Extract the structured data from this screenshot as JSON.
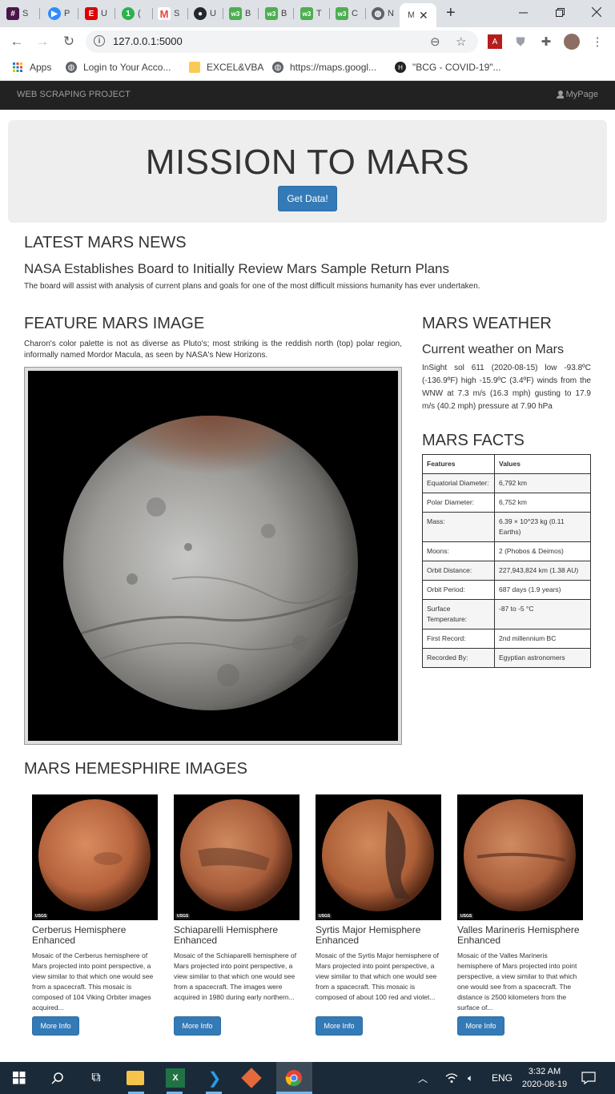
{
  "browser": {
    "tabs": [
      {
        "label": "S",
        "icon": "slack-icon",
        "color": "#4a154b"
      },
      {
        "label": "P",
        "icon": "zoom-icon",
        "color": "#2d8cff"
      },
      {
        "label": "U",
        "icon": "espn-icon",
        "color": "#d00"
      },
      {
        "label": "(",
        "icon": "counter-icon",
        "color": "#2bb24c"
      },
      {
        "label": "S",
        "icon": "gmail-icon",
        "color": "#ea4335"
      },
      {
        "label": "U",
        "icon": "github-icon",
        "color": "#24292e"
      },
      {
        "label": "B",
        "icon": "w3schools-icon",
        "color": "#4caf50"
      },
      {
        "label": "B",
        "icon": "w3schools-icon",
        "color": "#4caf50"
      },
      {
        "label": "T",
        "icon": "w3schools-icon",
        "color": "#4caf50"
      },
      {
        "label": "C",
        "icon": "w3schools-icon",
        "color": "#4caf50"
      },
      {
        "label": "N",
        "icon": "globe-icon",
        "color": "#5f6368"
      },
      {
        "label": "M",
        "icon": "page-icon",
        "color": "#5f6368"
      }
    ],
    "new_tab": "+",
    "url": "127.0.0.1:5000",
    "bookmarks": [
      {
        "label": "Apps",
        "icon": "apps-grid-icon"
      },
      {
        "label": "Login to Your Acco...",
        "icon": "globe-icon"
      },
      {
        "label": "EXCEL&VBA",
        "icon": "folder-icon"
      },
      {
        "label": "https://maps.googl...",
        "icon": "globe-icon"
      },
      {
        "label": "\"BCG - COVID-19\"...",
        "icon": "h-icon"
      }
    ]
  },
  "navbar": {
    "brand": "WEB SCRAPING PROJECT",
    "mypage": "MyPage"
  },
  "jumbotron": {
    "title": "MISSION TO MARS",
    "button": "Get Data!"
  },
  "news": {
    "heading": "LATEST MARS NEWS",
    "title": "NASA Establishes Board to Initially Review Mars Sample Return Plans",
    "paragraph": "The board will assist with analysis of current plans and goals for one of the most difficult missions humanity has ever undertaken."
  },
  "feature": {
    "heading": "FEATURE MARS IMAGE",
    "caption": "Charon's color palette is not as diverse as Pluto's; most striking is the reddish north (top) polar region, informally named Mordor Macula, as seen by NASA's New Horizons."
  },
  "weather": {
    "heading": "MARS WEATHER",
    "subheading": "Current weather on Mars",
    "text": "InSight sol 611 (2020-08-15) low -93.8ºC (-136.9ºF) high -15.9ºC (3.4ºF) winds from the WNW at 7.3 m/s (16.3 mph) gusting to 17.9 m/s (40.2 mph) pressure at 7.90 hPa"
  },
  "facts": {
    "heading": "MARS FACTS",
    "columns": [
      "Features",
      "Values"
    ],
    "rows": [
      [
        "Equatorial Diameter:",
        "6,792 km"
      ],
      [
        "Polar Diameter:",
        "6,752 km"
      ],
      [
        "Mass:",
        "6.39 × 10^23 kg (0.11 Earths)"
      ],
      [
        "Moons:",
        "2 (Phobos & Deimos)"
      ],
      [
        "Orbit Distance:",
        "227,943,824 km (1.38 AU)"
      ],
      [
        "Orbit Period:",
        "687 days (1.9 years)"
      ],
      [
        "Surface Temperature:",
        "-87 to -5 °C"
      ],
      [
        "First Record:",
        "2nd millennium BC"
      ],
      [
        "Recorded By:",
        "Egyptian astronomers"
      ]
    ]
  },
  "hemispheres": {
    "heading": "MARS HEMESPHIRE IMAGES",
    "items": [
      {
        "title": "Cerberus Hemisphere Enhanced",
        "desc": "Mosaic of the Cerberus hemisphere of Mars projected into point perspective, a view similar to that which one would see from a spacecraft. This mosaic is composed of 104 Viking Orbiter images acquired...",
        "button": "More Info",
        "badge": "USGS"
      },
      {
        "title": "Schiaparelli Hemisphere Enhanced",
        "desc": "Mosaic of the Schiaparelli hemisphere of Mars projected into point perspective, a view similar to that which one would see from a spacecraft. The images were acquired in 1980 during early northern...",
        "button": "More Info",
        "badge": "USGS"
      },
      {
        "title": "Syrtis Major Hemisphere Enhanced",
        "desc": "Mosaic of the Syrtis Major hemisphere of Mars projected into point perspective, a view similar to that which one would see from a spacecraft. This mosaic is composed of about 100 red and violet...",
        "button": "More Info",
        "badge": "USGS"
      },
      {
        "title": "Valles Marineris Hemisphere Enhanced",
        "desc": "Mosaic of the Valles Marineris hemisphere of Mars projected into point perspective, a view similar to that which one would see from a spacecraft. The distance is 2500 kilometers from the surface of...",
        "button": "More Info",
        "badge": "USGS"
      }
    ]
  },
  "taskbar": {
    "language": "ENG",
    "time": "3:32 AM",
    "date": "2020-08-19",
    "accent": "#76b9ed"
  }
}
